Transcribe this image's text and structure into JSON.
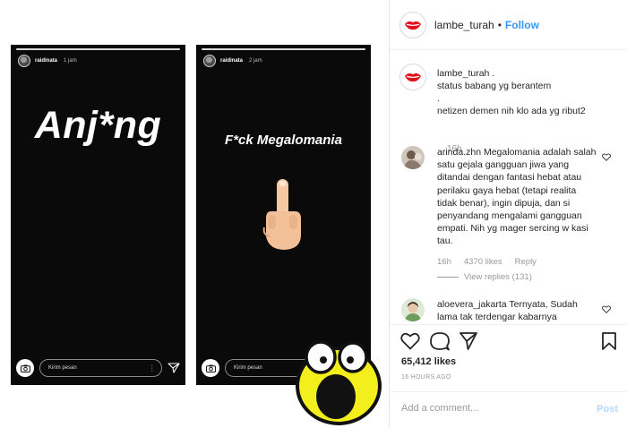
{
  "stories": [
    {
      "username": "raidinata",
      "time": "1 jam",
      "text": "Anj*ng",
      "message_placeholder": "Kirim pesan"
    },
    {
      "username": "raidinata",
      "time": "2 jam",
      "text": "F*ck Megalomania",
      "message_placeholder": "Kirim pesan"
    }
  ],
  "header": {
    "username": "lambe_turah",
    "separator": "•",
    "follow_label": "Follow"
  },
  "caption": {
    "username": "lambe_turah",
    "line1_suffix": ".",
    "line2": "status babang yg berantem",
    "line3": ".",
    "line4": "netizen demen nih klo ada yg ribut2",
    "time": "16h"
  },
  "comments": [
    {
      "username": "arinda.zhn",
      "text": "Megalomania adalah salah satu gejala gangguan jiwa yang ditandai dengan fantasi hebat atau perilaku gaya hebat (tetapi realita tidak benar), ingin dipuja, dan si penyandang mengalami gangguan empati. Nih yg mager sercing w kasi tau.",
      "time": "16h",
      "likes": "4370 likes",
      "reply_label": "Reply",
      "view_replies": "View replies (131)"
    },
    {
      "username": "aloevera_jakarta",
      "text": "Ternyata, Sudah lama tak terdengar kabarnya"
    }
  ],
  "actions": {
    "like_icon": "heart-icon",
    "comment_icon": "comment-icon",
    "share_icon": "share-icon",
    "save_icon": "bookmark-icon"
  },
  "likes_count": "65,412 likes",
  "posted_ago": "16 HOURS AGO",
  "add_comment": {
    "placeholder": "Add a comment...",
    "post_label": "Post"
  },
  "colors": {
    "link_blue": "#3897f0",
    "post_disabled": "#b3dbff",
    "story_bg": "#0a0a0a"
  }
}
